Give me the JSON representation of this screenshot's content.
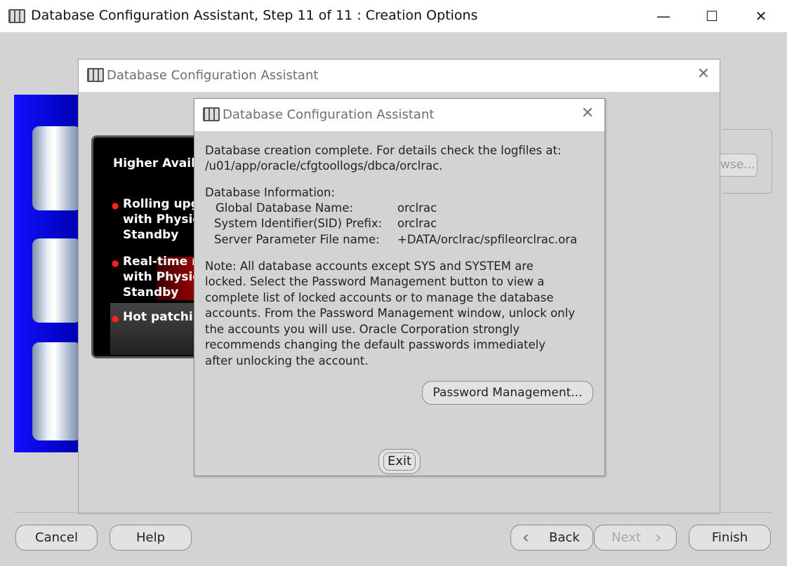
{
  "window": {
    "title": "Database Configuration Assistant, Step 11 of 11 : Creation Options",
    "controls": {
      "minimize": "—",
      "maximize": "☐",
      "close": "✕"
    }
  },
  "background_dialog": {
    "title": "Database Configuration Assistant",
    "close_glyph": "✕",
    "browse_label": "wse...",
    "promo": {
      "heading": "Higher Availa",
      "bullets": [
        {
          "lines": [
            "Rolling upg",
            "with Physic",
            "Standby"
          ]
        },
        {
          "lines": [
            "Real-time re",
            "with Physic",
            "Standby"
          ]
        },
        {
          "lines": [
            "Hot patchin"
          ]
        }
      ]
    }
  },
  "dialog": {
    "title": "Database Configuration Assistant",
    "close_glyph": "✕",
    "completion_lines": [
      "Database creation complete. For details check the logfiles at:",
      " /u01/app/oracle/cfgtoollogs/dbca/orclrac."
    ],
    "info_heading": "Database Information:",
    "info": [
      {
        "label": "Global Database Name:",
        "value": "orclrac"
      },
      {
        "label": "System Identifier(SID) Prefix:",
        "value": "orclrac"
      },
      {
        "label": "Server Parameter File name:",
        "value": "+DATA/orclrac/spfileorclrac.ora"
      }
    ],
    "note_lines": [
      "Note: All database accounts except SYS and SYSTEM are",
      "locked. Select the Password Management button to view a",
      "complete list of locked accounts or to manage the database",
      "accounts. From the Password Management window, unlock only",
      "the accounts you will use. Oracle Corporation strongly",
      "recommends changing the default passwords immediately",
      "after unlocking the account."
    ],
    "password_button": "Password Management...",
    "exit_button": "Exit"
  },
  "footer": {
    "cancel": "Cancel",
    "help": "Help",
    "back": "Back",
    "next": "Next",
    "finish": "Finish",
    "back_arrow": "‹",
    "next_arrow": "›"
  },
  "colors": {
    "progress": "#0000ff",
    "art_blue": "#1010ff",
    "bullet_red": "#ff2020"
  }
}
